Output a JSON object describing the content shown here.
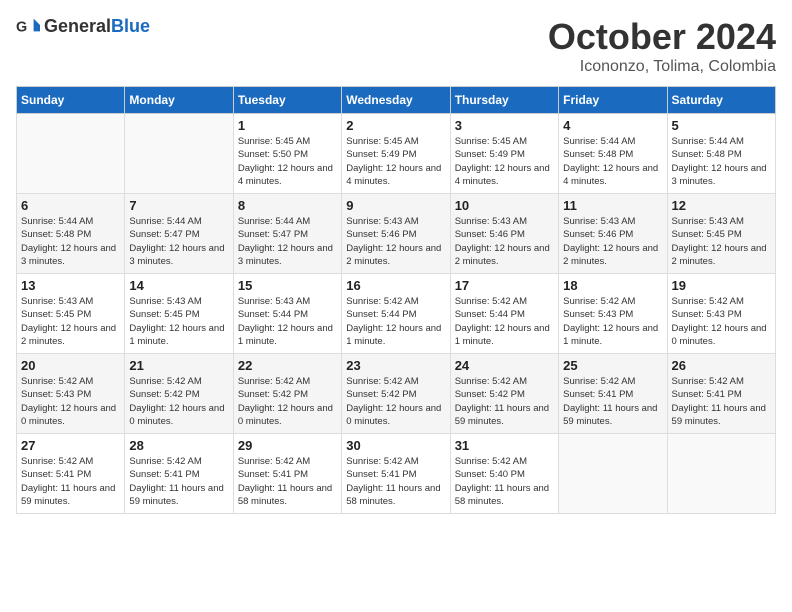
{
  "header": {
    "logo_general": "General",
    "logo_blue": "Blue",
    "month_title": "October 2024",
    "location": "Icononzo, Tolima, Colombia"
  },
  "weekdays": [
    "Sunday",
    "Monday",
    "Tuesday",
    "Wednesday",
    "Thursday",
    "Friday",
    "Saturday"
  ],
  "weeks": [
    [
      {
        "day": "",
        "info": ""
      },
      {
        "day": "",
        "info": ""
      },
      {
        "day": "1",
        "info": "Sunrise: 5:45 AM\nSunset: 5:50 PM\nDaylight: 12 hours and 4 minutes."
      },
      {
        "day": "2",
        "info": "Sunrise: 5:45 AM\nSunset: 5:49 PM\nDaylight: 12 hours and 4 minutes."
      },
      {
        "day": "3",
        "info": "Sunrise: 5:45 AM\nSunset: 5:49 PM\nDaylight: 12 hours and 4 minutes."
      },
      {
        "day": "4",
        "info": "Sunrise: 5:44 AM\nSunset: 5:48 PM\nDaylight: 12 hours and 4 minutes."
      },
      {
        "day": "5",
        "info": "Sunrise: 5:44 AM\nSunset: 5:48 PM\nDaylight: 12 hours and 3 minutes."
      }
    ],
    [
      {
        "day": "6",
        "info": "Sunrise: 5:44 AM\nSunset: 5:48 PM\nDaylight: 12 hours and 3 minutes."
      },
      {
        "day": "7",
        "info": "Sunrise: 5:44 AM\nSunset: 5:47 PM\nDaylight: 12 hours and 3 minutes."
      },
      {
        "day": "8",
        "info": "Sunrise: 5:44 AM\nSunset: 5:47 PM\nDaylight: 12 hours and 3 minutes."
      },
      {
        "day": "9",
        "info": "Sunrise: 5:43 AM\nSunset: 5:46 PM\nDaylight: 12 hours and 2 minutes."
      },
      {
        "day": "10",
        "info": "Sunrise: 5:43 AM\nSunset: 5:46 PM\nDaylight: 12 hours and 2 minutes."
      },
      {
        "day": "11",
        "info": "Sunrise: 5:43 AM\nSunset: 5:46 PM\nDaylight: 12 hours and 2 minutes."
      },
      {
        "day": "12",
        "info": "Sunrise: 5:43 AM\nSunset: 5:45 PM\nDaylight: 12 hours and 2 minutes."
      }
    ],
    [
      {
        "day": "13",
        "info": "Sunrise: 5:43 AM\nSunset: 5:45 PM\nDaylight: 12 hours and 2 minutes."
      },
      {
        "day": "14",
        "info": "Sunrise: 5:43 AM\nSunset: 5:45 PM\nDaylight: 12 hours and 1 minute."
      },
      {
        "day": "15",
        "info": "Sunrise: 5:43 AM\nSunset: 5:44 PM\nDaylight: 12 hours and 1 minute."
      },
      {
        "day": "16",
        "info": "Sunrise: 5:42 AM\nSunset: 5:44 PM\nDaylight: 12 hours and 1 minute."
      },
      {
        "day": "17",
        "info": "Sunrise: 5:42 AM\nSunset: 5:44 PM\nDaylight: 12 hours and 1 minute."
      },
      {
        "day": "18",
        "info": "Sunrise: 5:42 AM\nSunset: 5:43 PM\nDaylight: 12 hours and 1 minute."
      },
      {
        "day": "19",
        "info": "Sunrise: 5:42 AM\nSunset: 5:43 PM\nDaylight: 12 hours and 0 minutes."
      }
    ],
    [
      {
        "day": "20",
        "info": "Sunrise: 5:42 AM\nSunset: 5:43 PM\nDaylight: 12 hours and 0 minutes."
      },
      {
        "day": "21",
        "info": "Sunrise: 5:42 AM\nSunset: 5:42 PM\nDaylight: 12 hours and 0 minutes."
      },
      {
        "day": "22",
        "info": "Sunrise: 5:42 AM\nSunset: 5:42 PM\nDaylight: 12 hours and 0 minutes."
      },
      {
        "day": "23",
        "info": "Sunrise: 5:42 AM\nSunset: 5:42 PM\nDaylight: 12 hours and 0 minutes."
      },
      {
        "day": "24",
        "info": "Sunrise: 5:42 AM\nSunset: 5:42 PM\nDaylight: 11 hours and 59 minutes."
      },
      {
        "day": "25",
        "info": "Sunrise: 5:42 AM\nSunset: 5:41 PM\nDaylight: 11 hours and 59 minutes."
      },
      {
        "day": "26",
        "info": "Sunrise: 5:42 AM\nSunset: 5:41 PM\nDaylight: 11 hours and 59 minutes."
      }
    ],
    [
      {
        "day": "27",
        "info": "Sunrise: 5:42 AM\nSunset: 5:41 PM\nDaylight: 11 hours and 59 minutes."
      },
      {
        "day": "28",
        "info": "Sunrise: 5:42 AM\nSunset: 5:41 PM\nDaylight: 11 hours and 59 minutes."
      },
      {
        "day": "29",
        "info": "Sunrise: 5:42 AM\nSunset: 5:41 PM\nDaylight: 11 hours and 58 minutes."
      },
      {
        "day": "30",
        "info": "Sunrise: 5:42 AM\nSunset: 5:41 PM\nDaylight: 11 hours and 58 minutes."
      },
      {
        "day": "31",
        "info": "Sunrise: 5:42 AM\nSunset: 5:40 PM\nDaylight: 11 hours and 58 minutes."
      },
      {
        "day": "",
        "info": ""
      },
      {
        "day": "",
        "info": ""
      }
    ]
  ]
}
